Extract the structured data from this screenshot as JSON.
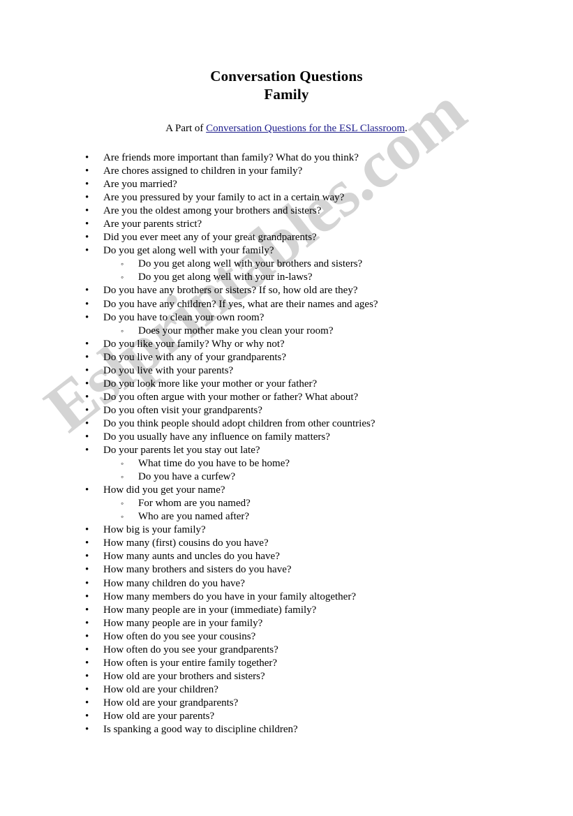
{
  "document": {
    "title_line_1": "Conversation Questions",
    "title_line_2": "Family",
    "attribution": {
      "lead": "A Part of ",
      "link_text": "Conversation Questions for the ESL Classroom",
      "tail": "."
    },
    "watermark": "Eslprintables.com",
    "watermark_color": "#d4d4d4",
    "link_color": "#1d1d8c",
    "bullet_level_1": "•",
    "bullet_level_2": "◦"
  },
  "questions": [
    {
      "level": 1,
      "text": "Are friends more important than family? What do you think?"
    },
    {
      "level": 1,
      "text": "Are chores assigned to children in your family?"
    },
    {
      "level": 1,
      "text": "Are you married?"
    },
    {
      "level": 1,
      "text": "Are you pressured by your family to act in a certain way?"
    },
    {
      "level": 1,
      "text": "Are you the oldest among your brothers and sisters?"
    },
    {
      "level": 1,
      "text": "Are your parents strict?"
    },
    {
      "level": 1,
      "text": "Did you ever meet any of your great grandparents?"
    },
    {
      "level": 1,
      "text": "Do you get along well with your family?"
    },
    {
      "level": 2,
      "text": "Do you get along well with your brothers and sisters?"
    },
    {
      "level": 2,
      "text": "Do you get along well with your in-laws?"
    },
    {
      "level": 1,
      "text": "Do you have any brothers or sisters? If so, how old are they?"
    },
    {
      "level": 1,
      "text": "Do you have any children? If yes, what are their names and ages?"
    },
    {
      "level": 1,
      "text": "Do you have to clean your own room?"
    },
    {
      "level": 2,
      "text": "Does your mother make you clean your room?"
    },
    {
      "level": 1,
      "text": "Do you like your family? Why or why not?"
    },
    {
      "level": 1,
      "text": "Do you live with any of your grandparents?"
    },
    {
      "level": 1,
      "text": "Do you live with your parents?"
    },
    {
      "level": 1,
      "text": "Do you look more like your mother or your father?"
    },
    {
      "level": 1,
      "text": "Do you often argue with your mother or father? What about?"
    },
    {
      "level": 1,
      "text": "Do you often visit your grandparents?"
    },
    {
      "level": 1,
      "text": "Do you think people should adopt children from other countries?"
    },
    {
      "level": 1,
      "text": "Do you usually have any influence on family matters?"
    },
    {
      "level": 1,
      "text": "Do your parents let you stay out late?"
    },
    {
      "level": 2,
      "text": "What time do you have to be home?"
    },
    {
      "level": 2,
      "text": "Do you have a curfew?"
    },
    {
      "level": 1,
      "text": "How did you get your name?"
    },
    {
      "level": 2,
      "text": "For whom are you named?"
    },
    {
      "level": 2,
      "text": "Who are you named after?"
    },
    {
      "level": 1,
      "text": "How big is your family?"
    },
    {
      "level": 1,
      "text": "How many (first) cousins do you have?"
    },
    {
      "level": 1,
      "text": "How many aunts and uncles do you have?"
    },
    {
      "level": 1,
      "text": "How many brothers and sisters do you have?"
    },
    {
      "level": 1,
      "text": "How many children do you have?"
    },
    {
      "level": 1,
      "text": "How many members do you have in your family altogether?"
    },
    {
      "level": 1,
      "text": "How many people are in your (immediate) family?"
    },
    {
      "level": 1,
      "text": "How many people are in your family?"
    },
    {
      "level": 1,
      "text": "How often do you see your cousins?"
    },
    {
      "level": 1,
      "text": "How often do you see your grandparents?"
    },
    {
      "level": 1,
      "text": "How often is your entire family together?"
    },
    {
      "level": 1,
      "text": "How old are your brothers and sisters?"
    },
    {
      "level": 1,
      "text": "How old are your children?"
    },
    {
      "level": 1,
      "text": "How old are your grandparents?"
    },
    {
      "level": 1,
      "text": "How old are your parents?"
    },
    {
      "level": 1,
      "text": "Is spanking a good way to discipline children?"
    }
  ]
}
